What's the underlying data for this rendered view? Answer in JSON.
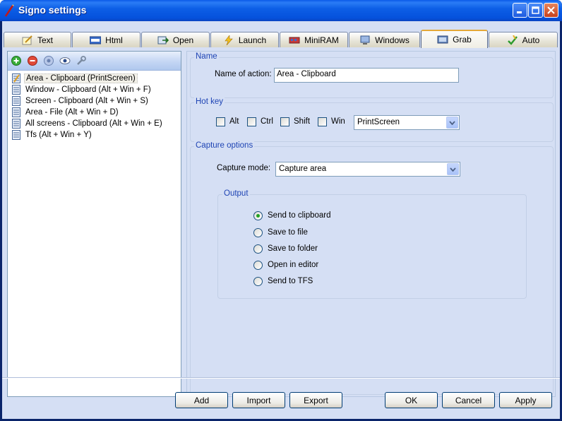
{
  "window": {
    "title": "Signo settings"
  },
  "tabs": [
    {
      "label": "Text",
      "icon": "pencil-note-icon"
    },
    {
      "label": "Html",
      "icon": "html-icon"
    },
    {
      "label": "Open",
      "icon": "open-icon"
    },
    {
      "label": "Launch",
      "icon": "lightning-icon"
    },
    {
      "label": "MiniRAM",
      "icon": "ram-icon"
    },
    {
      "label": "Windows",
      "icon": "windows-icon"
    },
    {
      "label": "Grab",
      "icon": "grab-icon",
      "active": true
    },
    {
      "label": "Auto",
      "icon": "auto-icon"
    }
  ],
  "sidebar": {
    "toolbar": [
      "add-icon",
      "remove-icon",
      "help-icon",
      "preview-icon",
      "settings-wrench-icon"
    ],
    "items": [
      {
        "label": "Area - Clipboard (PrintScreen)",
        "selected": true
      },
      {
        "label": "Window - Clipboard (Alt + Win + F)"
      },
      {
        "label": "Screen - Clipboard (Alt + Win + S)"
      },
      {
        "label": "Area - File (Alt + Win + D)"
      },
      {
        "label": "All screens - Clipboard (Alt + Win + E)"
      },
      {
        "label": "Tfs (Alt + Win + Y)"
      }
    ]
  },
  "name_group": {
    "title": "Name",
    "field_label": "Name of action:",
    "field_value": "Area - Clipboard"
  },
  "hotkey_group": {
    "title": "Hot key",
    "alt": "Alt",
    "ctrl": "Ctrl",
    "shift": "Shift",
    "win": "Win",
    "key_value": "PrintScreen"
  },
  "capture_group": {
    "title": "Capture options",
    "mode_label": "Capture mode:",
    "mode_value": "Capture area",
    "output": {
      "title": "Output",
      "options": [
        "Send to clipboard",
        "Save to file",
        "Save to folder",
        "Open in editor",
        "Send to TFS"
      ],
      "selected": 0
    }
  },
  "buttons": {
    "add": "Add",
    "import": "Import",
    "export": "Export",
    "ok": "OK",
    "cancel": "Cancel",
    "apply": "Apply"
  },
  "colors": {
    "titlebar": "#0551dc",
    "client": "#d5dff4",
    "group_title": "#1e44b4"
  }
}
